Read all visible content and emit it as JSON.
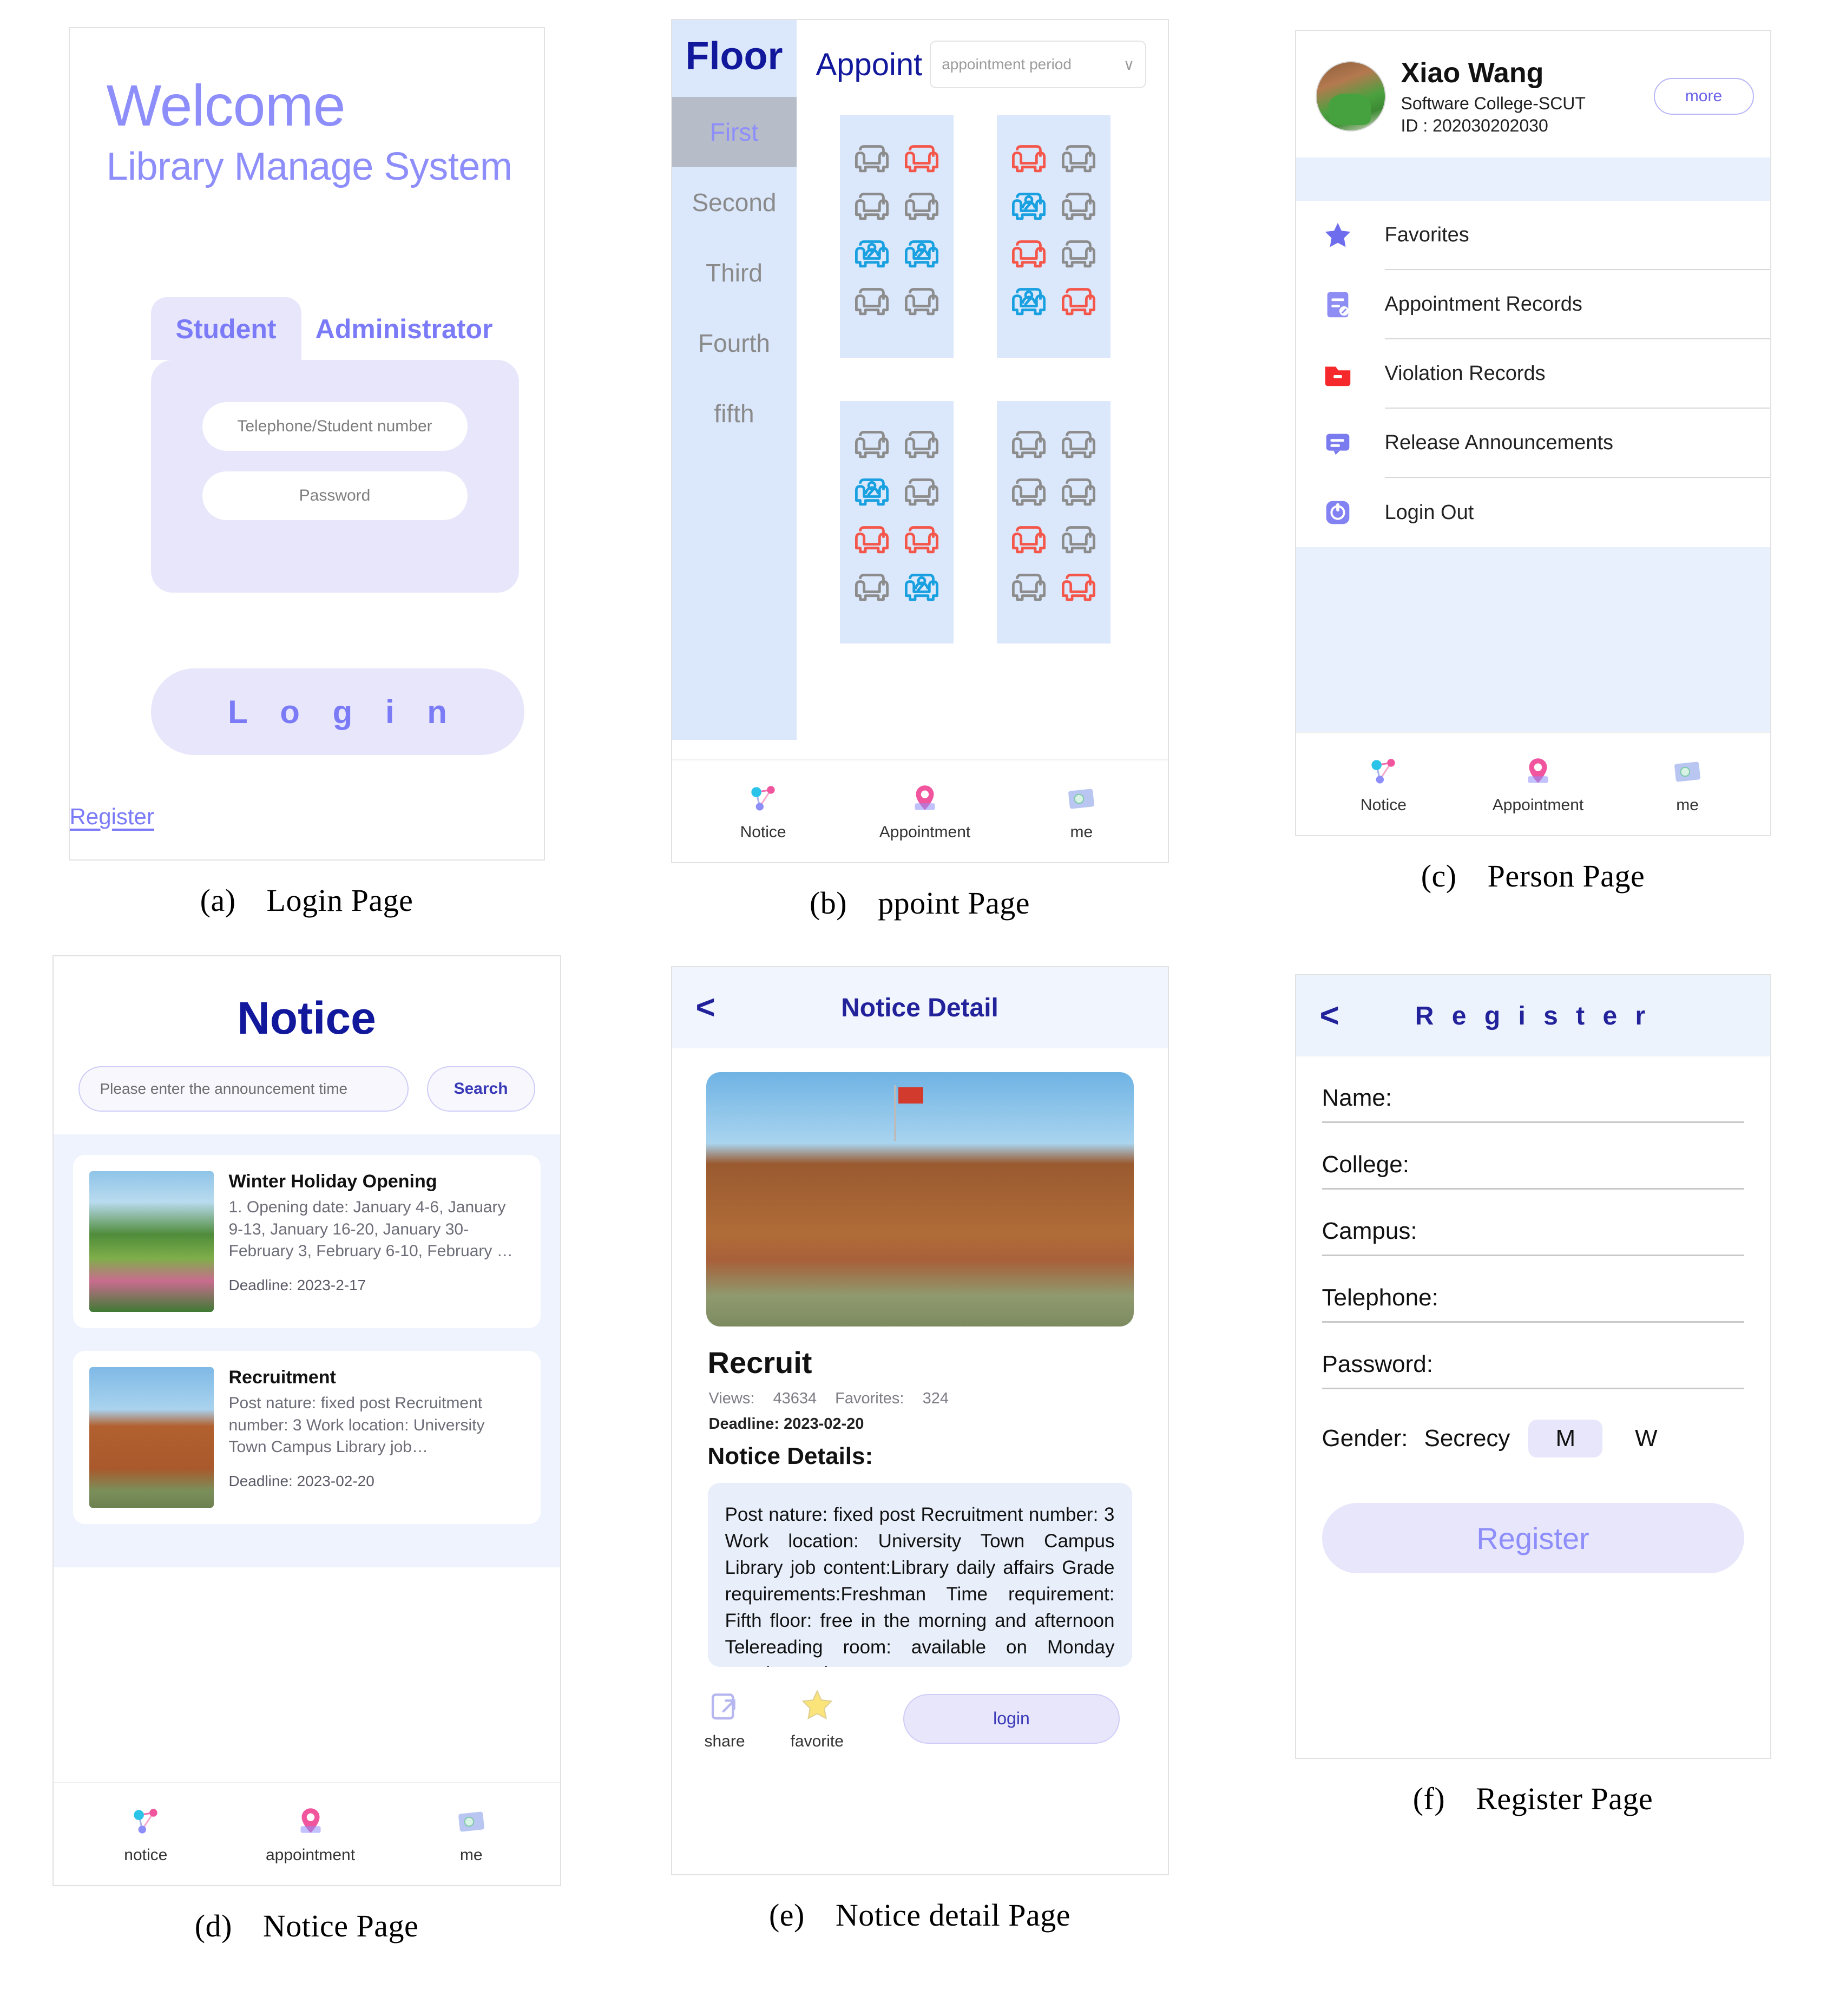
{
  "colors": {
    "accent_purple": "#8e8efb",
    "accent_purple_dark": "#7b7bf7",
    "navy": "#11189c",
    "panel_blue": "#dbe7fb",
    "light_blue": "#e8f0fd",
    "lilac": "#e7e6fb",
    "seat_free": "#8c8c8c",
    "seat_booked": "#f4564a",
    "seat_occupied": "#18a0e0"
  },
  "captions": [
    {
      "label": "(a)",
      "text": "Login Page"
    },
    {
      "label": "(b)",
      "text": "ppoint Page"
    },
    {
      "label": "(c)",
      "text": "Person Page"
    },
    {
      "label": "(d)",
      "text": "Notice Page"
    },
    {
      "label": "(e)",
      "text": "Notice detail Page"
    },
    {
      "label": "(f)",
      "text": "Register Page"
    }
  ],
  "login": {
    "welcome": "Welcome",
    "subtitle": "Library Manage System",
    "tabs": [
      {
        "label": "Student",
        "active": true
      },
      {
        "label": "Administrator",
        "active": false
      }
    ],
    "username_placeholder": "Telephone/Student number",
    "password_placeholder": "Password",
    "login_button": "L o g i n",
    "register_link": "Register"
  },
  "appoint": {
    "floor_title": "Floor",
    "floors": [
      {
        "label": "First",
        "selected": true
      },
      {
        "label": "Second",
        "selected": false
      },
      {
        "label": "Third",
        "selected": false
      },
      {
        "label": "Fourth",
        "selected": false
      },
      {
        "label": "fifth",
        "selected": false
      }
    ],
    "appoint_label": "Appoint",
    "period_value": "appointment period",
    "chevron": "∨",
    "zones": [
      {
        "name": "zone-top-left",
        "rows": [
          [
            "free",
            "booked"
          ],
          [
            "free",
            "free"
          ],
          [
            "occupied",
            "occupied"
          ],
          [
            "free",
            "free"
          ]
        ]
      },
      {
        "name": "zone-top-right",
        "rows": [
          [
            "booked",
            "free"
          ],
          [
            "occupied",
            "free"
          ],
          [
            "booked",
            "free"
          ],
          [
            "occupied",
            "booked"
          ]
        ]
      },
      {
        "name": "zone-bottom-left",
        "rows": [
          [
            "free",
            "free"
          ],
          [
            "occupied",
            "free"
          ],
          [
            "booked",
            "booked"
          ],
          [
            "free",
            "occupied"
          ]
        ]
      },
      {
        "name": "zone-bottom-right",
        "rows": [
          [
            "free",
            "free"
          ],
          [
            "free",
            "free"
          ],
          [
            "booked",
            "free"
          ],
          [
            "free",
            "booked"
          ]
        ]
      }
    ],
    "nav": [
      {
        "label": "Notice",
        "icon": "share-nodes-icon"
      },
      {
        "label": "Appointment",
        "icon": "map-pin-icon"
      },
      {
        "label": "me",
        "icon": "card-photo-icon"
      }
    ]
  },
  "person": {
    "name": "Xiao Wang",
    "college": "Software College-SCUT",
    "id": "ID : 202030202030",
    "more_button": "more",
    "menu": [
      {
        "label": "Favorites",
        "icon": "star-icon"
      },
      {
        "label": "Appointment Records",
        "icon": "note-edit-icon"
      },
      {
        "label": "Violation Records",
        "icon": "red-folder-icon"
      },
      {
        "label": "Release Announcements",
        "icon": "announcement-icon"
      },
      {
        "label": "Login Out",
        "icon": "power-icon"
      }
    ],
    "nav": [
      {
        "label": "Notice",
        "icon": "share-nodes-icon"
      },
      {
        "label": "Appointment",
        "icon": "map-pin-icon"
      },
      {
        "label": "me",
        "icon": "card-photo-icon"
      }
    ]
  },
  "notice": {
    "title": "Notice",
    "search_placeholder": "Please enter the announcement time",
    "search_button": "Search",
    "cards": [
      {
        "title": "Winter Holiday Opening",
        "desc": "1. Opening date: January 4-6, January 9-13, January 16-20, January 30-February 3, February 6-10, February …",
        "deadline": "Deadline: 2023-2-17",
        "image": "park-photo"
      },
      {
        "title": "Recruitment",
        "desc": "Post nature: fixed post Recruitment number: 3 Work location: University Town Campus Library job…",
        "deadline": "Deadline: 2023-02-20",
        "image": "library-building-photo"
      }
    ],
    "nav": [
      {
        "label": "notice",
        "icon": "share-nodes-icon"
      },
      {
        "label": "appointment",
        "icon": "map-pin-icon"
      },
      {
        "label": "me",
        "icon": "card-photo-icon"
      }
    ]
  },
  "notice_detail": {
    "header_title": "Notice Detail",
    "back": "<",
    "hero_image": "library-building-photo",
    "title": "Recruit",
    "views_label": "Views:",
    "views_value": "43634",
    "favorites_label": "Favorites:",
    "favorites_value": "324",
    "deadline": "Deadline: 2023-02-20",
    "details_heading": "Notice Details:",
    "body": "Post nature: fixed post Recruitment number: 3 Work location: University Town Campus Library job content:Library daily affairs Grade requirements:Freshman Time requirement: Fifth floor: free in the morning and afternoon Telereading room: available on Monday evening and",
    "actions": [
      {
        "label": "share",
        "icon": "share-box-icon"
      },
      {
        "label": "favorite",
        "icon": "star-icon"
      }
    ],
    "login_button": "login"
  },
  "register": {
    "header_title": "R e g i s t e r",
    "back": "<",
    "fields": [
      "Name:",
      "College:",
      "Campus:",
      "Telephone:",
      "Password:"
    ],
    "gender_label": "Gender:",
    "gender_options": [
      {
        "label": "Secrecy",
        "selected": false
      },
      {
        "label": "M",
        "selected": true
      },
      {
        "label": "W",
        "selected": false
      }
    ],
    "submit_button": "Register"
  }
}
